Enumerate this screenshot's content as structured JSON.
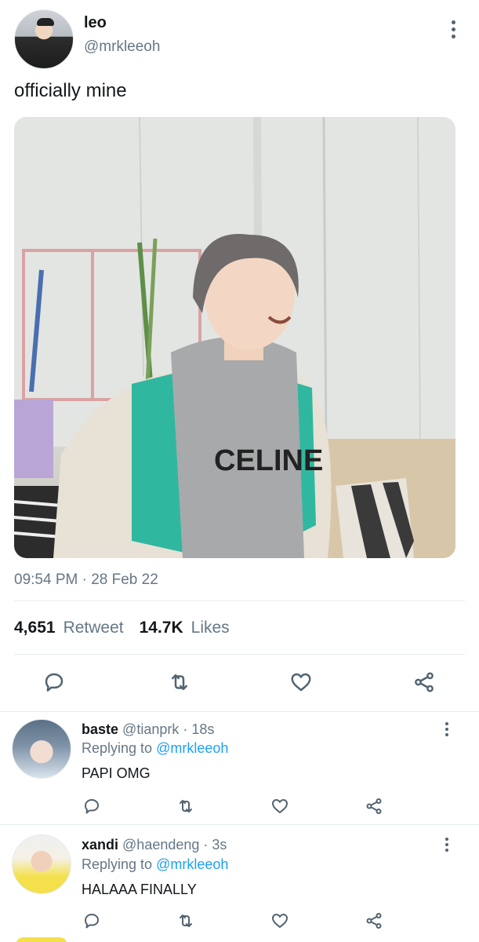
{
  "tweet": {
    "author_name": "leo",
    "author_handle": "@mrkleeoh",
    "text": "officially mine",
    "timestamp": "09:54 PM · 28 Feb 22",
    "media_text": "CELINE",
    "stats": {
      "retweets_count": "4,651",
      "retweets_label": "Retweet",
      "likes_count": "14.7K",
      "likes_label": "Likes"
    },
    "actions": [
      "reply-icon",
      "retweet-icon",
      "like-icon",
      "share-icon"
    ]
  },
  "replies": [
    {
      "name": "baste",
      "handle": "@tianprk",
      "time": "18s",
      "replying_prefix": "Replying to",
      "replying_handle": "@mrkleeoh",
      "text": "PAPI OMG"
    },
    {
      "name": "xandi",
      "handle": "@haendeng",
      "time": "3s",
      "replying_prefix": "Replying to",
      "replying_handle": "@mrkleeoh",
      "text": "HALAAA FINALLY"
    }
  ],
  "colors": {
    "text_primary": "#14171a",
    "text_secondary": "#657786",
    "link": "#1da1f2",
    "icon": "#536471",
    "divider": "#e6ecf0"
  }
}
